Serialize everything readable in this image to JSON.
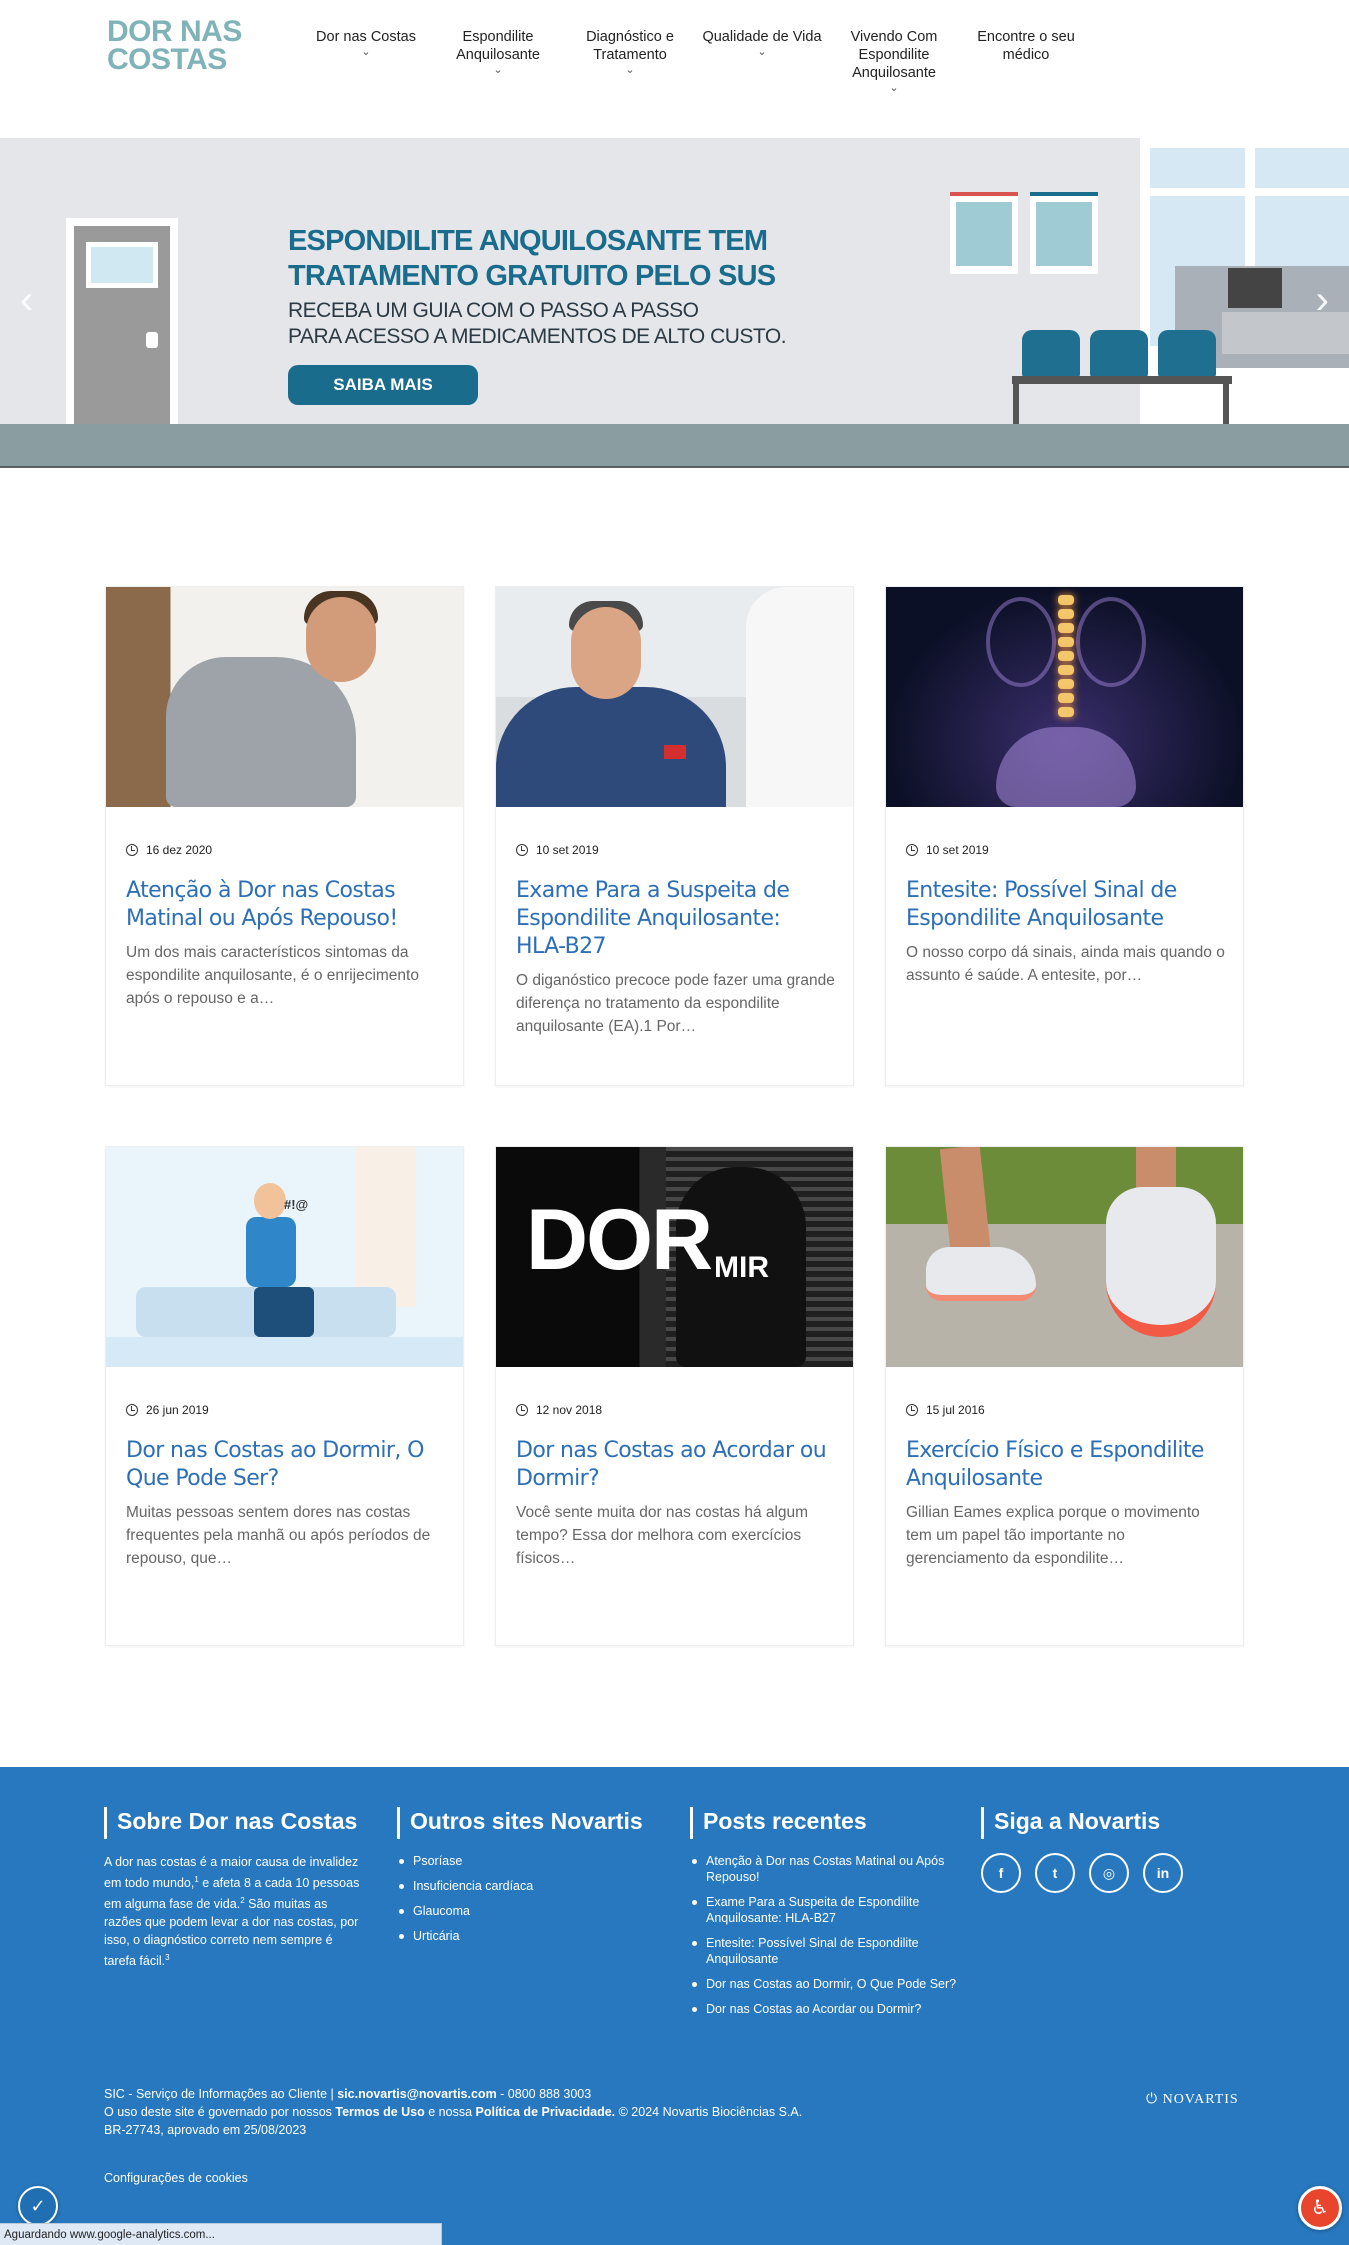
{
  "header": {
    "logo_line1": "DOR NAS",
    "logo_line2": "COSTAS",
    "nav": [
      {
        "label": "Dor nas Costas",
        "has_dropdown": true
      },
      {
        "label": "Espondilite Anquilosante",
        "has_dropdown": true
      },
      {
        "label": "Diagnóstico e Tratamento",
        "has_dropdown": true
      },
      {
        "label": "Qualidade de Vida",
        "has_dropdown": true
      },
      {
        "label": "Vivendo Com Espondilite Anquilosante",
        "has_dropdown": true
      },
      {
        "label": "Encontre o seu médico",
        "has_dropdown": false
      }
    ],
    "dropdown_glyph": "⌄"
  },
  "hero": {
    "title_line1": "ESPONDILITE ANQUILOSANTE TEM",
    "title_line2": "TRATAMENTO GRATUITO PELO SUS",
    "sub_line1": "RECEBA UM GUIA COM O PASSO A PASSO",
    "sub_line2": "PARA ACESSO A MEDICAMENTOS DE ALTO CUSTO.",
    "button": "SAIBA MAIS",
    "prev_icon": "chevron-left-icon",
    "next_icon": "chevron-right-icon",
    "prev_glyph": "‹",
    "next_glyph": "›"
  },
  "posts": [
    {
      "date": "16 dez 2020",
      "title": "Atenção à Dor nas Costas Matinal ou Após Repouso!",
      "excerpt": "Um dos mais característicos sintomas da espondilite anquilosante, é o enrijecimento após o repouso e a…"
    },
    {
      "date": "10 set 2019",
      "title": "Exame Para a Suspeita de Espondilite Anquilosante: HLA-B27",
      "excerpt": "O diganóstico precoce pode fazer uma grande diferença no tratamento da espondilite anquilosante (EA).1 Por…"
    },
    {
      "date": "10 set 2019",
      "title": "Entesite: Possível Sinal de Espondilite Anquilosante",
      "excerpt": "O nosso corpo dá sinais, ainda mais quando o assunto é saúde. A entesite, por…"
    },
    {
      "date": "26 jun 2019",
      "title": "Dor nas Costas ao Dormir, O Que Pode Ser?",
      "excerpt": "Muitas pessoas sentem dores nas costas frequentes pela manhã ou após períodos de repouso, que…"
    },
    {
      "date": "12 nov 2018",
      "title": "Dor nas Costas ao Acordar ou Dormir?",
      "excerpt": "Você sente muita dor nas costas há algum tempo? Essa dor melhora com exercícios físicos…"
    },
    {
      "date": "15 jul 2016",
      "title": "Exercício Físico e Espondilite Anquilosante",
      "excerpt": "Gillian Eames explica porque o movimento tem um papel tão importante no gerenciamento da espondilite…"
    }
  ],
  "post_images": {
    "dor_big": "DOR",
    "dor_small": "MIR",
    "cartoon_symbols": "#!@"
  },
  "footer": {
    "about_title": "Sobre Dor nas Costas",
    "about_text_1": "A dor nas costas é a maior causa de invalidez em todo mundo,",
    "about_sup_1": "1",
    "about_text_2": " e afeta 8 a cada 10 pessoas em alguma fase de vida.",
    "about_sup_2": "2",
    "about_text_3": " São muitas as razões que podem levar a dor nas costas, por isso, o diagnóstico correto nem sempre é tarefa fácil.",
    "about_sup_3": "3",
    "sites_title": "Outros sites Novartis",
    "sites": [
      "Psoríase",
      "Insuficiencia cardíaca",
      "Glaucoma",
      "Urticária"
    ],
    "recent_title": "Posts recentes",
    "recent": [
      "Atenção à Dor nas Costas Matinal ou Após Repouso!",
      "Exame Para a Suspeita de Espondilite Anquilosante: HLA-B27",
      "Entesite: Possível Sinal de Espondilite Anquilosante",
      "Dor nas Costas ao Dormir, O Que Pode Ser?",
      "Dor nas Costas ao Acordar ou Dormir?"
    ],
    "follow_title": "Siga a Novartis",
    "social": [
      {
        "icon": "facebook-icon",
        "glyph": "f"
      },
      {
        "icon": "twitter-icon",
        "glyph": "t"
      },
      {
        "icon": "instagram-icon",
        "glyph": "◎"
      },
      {
        "icon": "linkedin-icon",
        "glyph": "in"
      }
    ],
    "sic_prefix": "SIC - Serviço de Informações ao Cliente | ",
    "sic_email": "sic.novartis@novartis.com",
    "sic_phone": " - 0800 888 3003",
    "terms_prefix": "O uso deste site é governado por nossos ",
    "terms_link": "Termos de Uso",
    "terms_mid": " e nossa ",
    "privacy_link": "Política de Privacidade.",
    "copyright": " © 2024 Novartis Biociências S.A.",
    "approval": "BR-27743, aprovado em 25/08/2023",
    "novartis_logo": "NOVARTIS",
    "cookies": "Configurações de cookies"
  },
  "widgets": {
    "shield_icon": "shield-icon",
    "accessibility_icon": "accessibility-icon",
    "shield_glyph": "✓",
    "access_glyph": "♿"
  },
  "statusbar": "Aguardando www.google-analytics.com..."
}
